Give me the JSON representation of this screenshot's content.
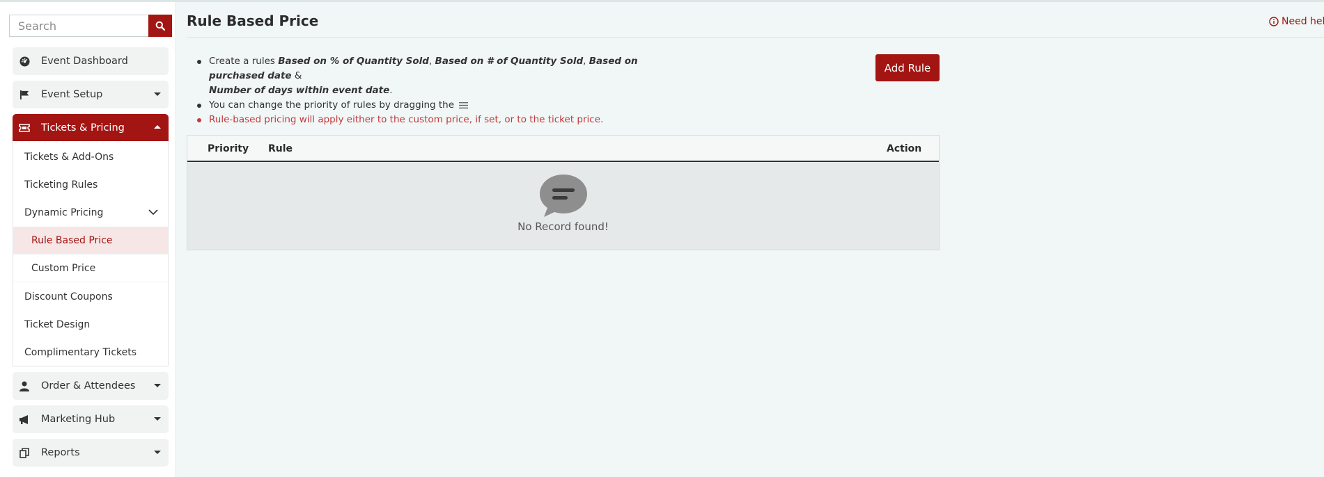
{
  "sidebar": {
    "search": {
      "placeholder": "Search"
    },
    "items": [
      {
        "label": "Event Dashboard"
      },
      {
        "label": "Event Setup"
      },
      {
        "label": "Tickets & Pricing"
      },
      {
        "label": "Order & Attendees"
      },
      {
        "label": "Marketing Hub"
      },
      {
        "label": "Reports"
      }
    ],
    "tickets_submenu": [
      {
        "label": "Tickets & Add-Ons"
      },
      {
        "label": "Ticketing Rules"
      },
      {
        "label": "Dynamic Pricing"
      },
      {
        "label": "Discount Coupons"
      },
      {
        "label": "Ticket Design"
      },
      {
        "label": "Complimentary Tickets"
      }
    ],
    "dynamic_pricing_submenu": [
      {
        "label": "Rule Based Price",
        "selected": true
      },
      {
        "label": "Custom Price"
      }
    ]
  },
  "header": {
    "title": "Rule Based Price",
    "help_label": "Need help"
  },
  "info": {
    "line1_prefix": "Create a rules ",
    "rule_types": [
      "Based on % of Quantity Sold",
      "Based on # of Quantity Sold",
      "Based on purchased date",
      "Number of days within event date"
    ],
    "sep_comma": ", ",
    "sep_amp": " & ",
    "period": ".",
    "line2": "You can change the priority of rules by dragging the ",
    "line3": "Rule-based pricing will apply either to the custom price, if set, or to the ticket price."
  },
  "actions": {
    "add_rule_label": "Add Rule"
  },
  "table": {
    "columns": [
      "Priority",
      "Rule",
      "Action"
    ],
    "empty_text": "No Record found!"
  },
  "colors": {
    "brand": "#a31512",
    "warning_text": "#c3383b",
    "selected_bg": "#f6e6e6",
    "page_bg": "#f1f6f6"
  }
}
